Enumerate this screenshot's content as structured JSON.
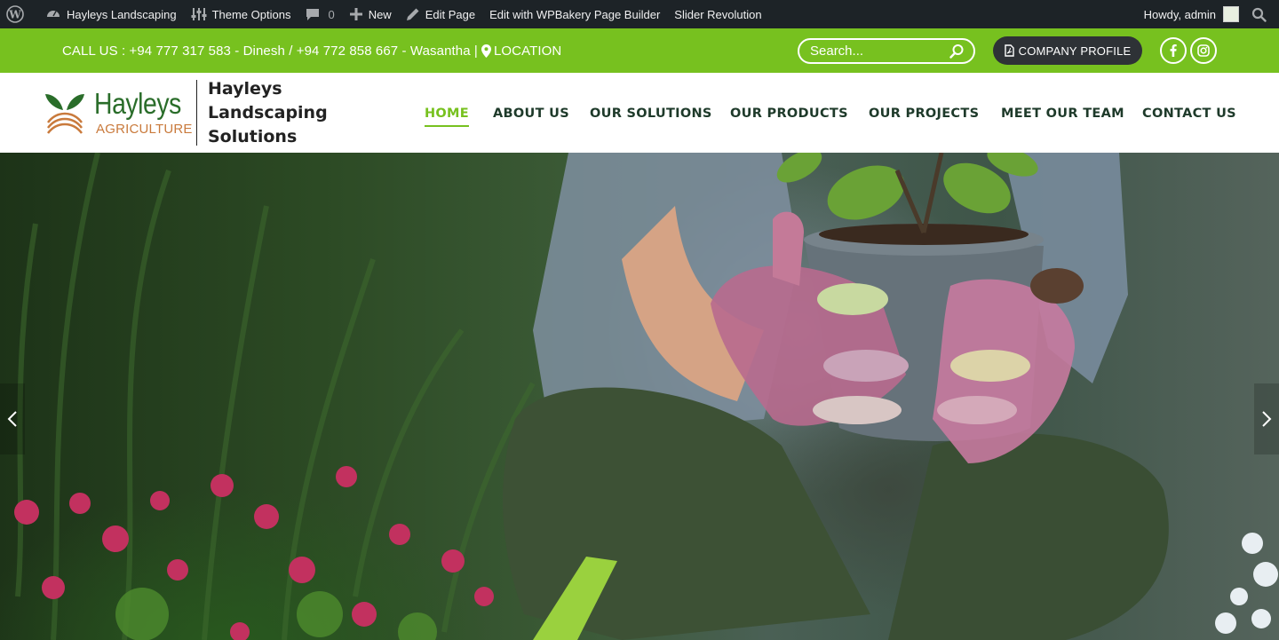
{
  "adminbar": {
    "site_name": "Hayleys Landscaping",
    "theme_options": "Theme Options",
    "comments_count": "0",
    "new_label": "New",
    "edit_page": "Edit Page",
    "wpbakery": "Edit with WPBakery Page Builder",
    "slider": "Slider Revolution",
    "howdy": "Howdy, admin"
  },
  "topbar": {
    "contact_text": "CALL US : +94 777 317 583 - Dinesh / +94 772 858 667 - Wasantha |",
    "location_label": "LOCATION",
    "search_placeholder": "Search...",
    "company_profile": "COMPANY PROFILE"
  },
  "header": {
    "logo_brand": "Hayleys",
    "logo_sub": "AGRICULTURE",
    "title_lines": [
      "Hayleys",
      "Landscaping",
      "Solutions"
    ]
  },
  "nav": {
    "items": [
      {
        "label": "HOME",
        "active": true
      },
      {
        "label": "ABOUT US"
      },
      {
        "label": "OUR SOLUTIONS"
      },
      {
        "label": "OUR PRODUCTS"
      },
      {
        "label": "OUR PROJECTS"
      },
      {
        "label": "MEET OUR TEAM"
      },
      {
        "label": "CONTACT US"
      }
    ]
  },
  "colors": {
    "accent_green": "#77c11f",
    "admin_bar": "#1d2327",
    "button_dark": "#2e3236",
    "logo_green": "#2a6d2a",
    "logo_orange": "#c97a3c"
  },
  "icons": {
    "wordpress": "wordpress-logo-icon",
    "customize": "dashboard-icon",
    "sliders": "sliders-icon",
    "comment": "comment-bubble-icon",
    "plus": "plus-icon",
    "pencil": "pencil-icon",
    "search": "search-icon",
    "pin": "map-pin-icon",
    "pdf": "pdf-file-icon",
    "facebook": "facebook-icon",
    "instagram": "instagram-icon"
  }
}
